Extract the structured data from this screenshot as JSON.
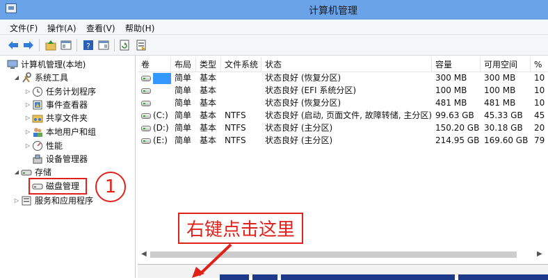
{
  "window": {
    "title": "计算机管理"
  },
  "menu": [
    "文件(F)",
    "操作(A)",
    "查看(V)",
    "帮助(H)"
  ],
  "toolbar_icons": [
    "back-arrow-icon",
    "forward-arrow-icon",
    "up-folder-icon",
    "show-hide-tree-icon",
    "help-icon",
    "console-pane-icon",
    "refresh-icon",
    "export-icon"
  ],
  "tree": {
    "root": "计算机管理(本地)",
    "system_tools": "系统工具",
    "task_scheduler": "任务计划程序",
    "event_viewer": "事件查看器",
    "shared_folders": "共享文件夹",
    "local_users": "本地用户和组",
    "performance": "性能",
    "device_manager": "设备管理器",
    "storage": "存储",
    "disk_management": "磁盘管理",
    "services_apps": "服务和应用程序"
  },
  "table": {
    "headers": [
      "卷",
      "布局",
      "类型",
      "文件系统",
      "状态",
      "容量",
      "可用空间",
      "%"
    ],
    "rows": [
      {
        "vol": "",
        "layout": "简单",
        "type": "基本",
        "fs": "",
        "status": "状态良好 (恢复分区)",
        "cap": "300 MB",
        "free": "300 MB",
        "pct": "10"
      },
      {
        "vol": "",
        "layout": "简单",
        "type": "基本",
        "fs": "",
        "status": "状态良好 (EFI 系统分区)",
        "cap": "100 MB",
        "free": "100 MB",
        "pct": "10"
      },
      {
        "vol": "",
        "layout": "简单",
        "type": "基本",
        "fs": "",
        "status": "状态良好 (恢复分区)",
        "cap": "481 MB",
        "free": "481 MB",
        "pct": "10"
      },
      {
        "vol": "(C:)",
        "layout": "简单",
        "type": "基本",
        "fs": "NTFS",
        "status": "状态良好 (启动, 页面文件, 故障转储, 主分区)",
        "cap": "99.63 GB",
        "free": "45.33 GB",
        "pct": "45"
      },
      {
        "vol": "(D:)",
        "layout": "简单",
        "type": "基本",
        "fs": "NTFS",
        "status": "状态良好 (主分区)",
        "cap": "150.20 GB",
        "free": "30.18 GB",
        "pct": "20"
      },
      {
        "vol": "(E:)",
        "layout": "简单",
        "type": "基本",
        "fs": "NTFS",
        "status": "状态良好 (主分区)",
        "cap": "214.95 GB",
        "free": "169.60 GB",
        "pct": "79"
      }
    ]
  },
  "annotations": {
    "step_number": "1",
    "callout": "右键点击这里"
  },
  "colors": {
    "title_bar": "#6aa3e8",
    "annotation": "#e0211a",
    "selection": "#3399ff"
  }
}
